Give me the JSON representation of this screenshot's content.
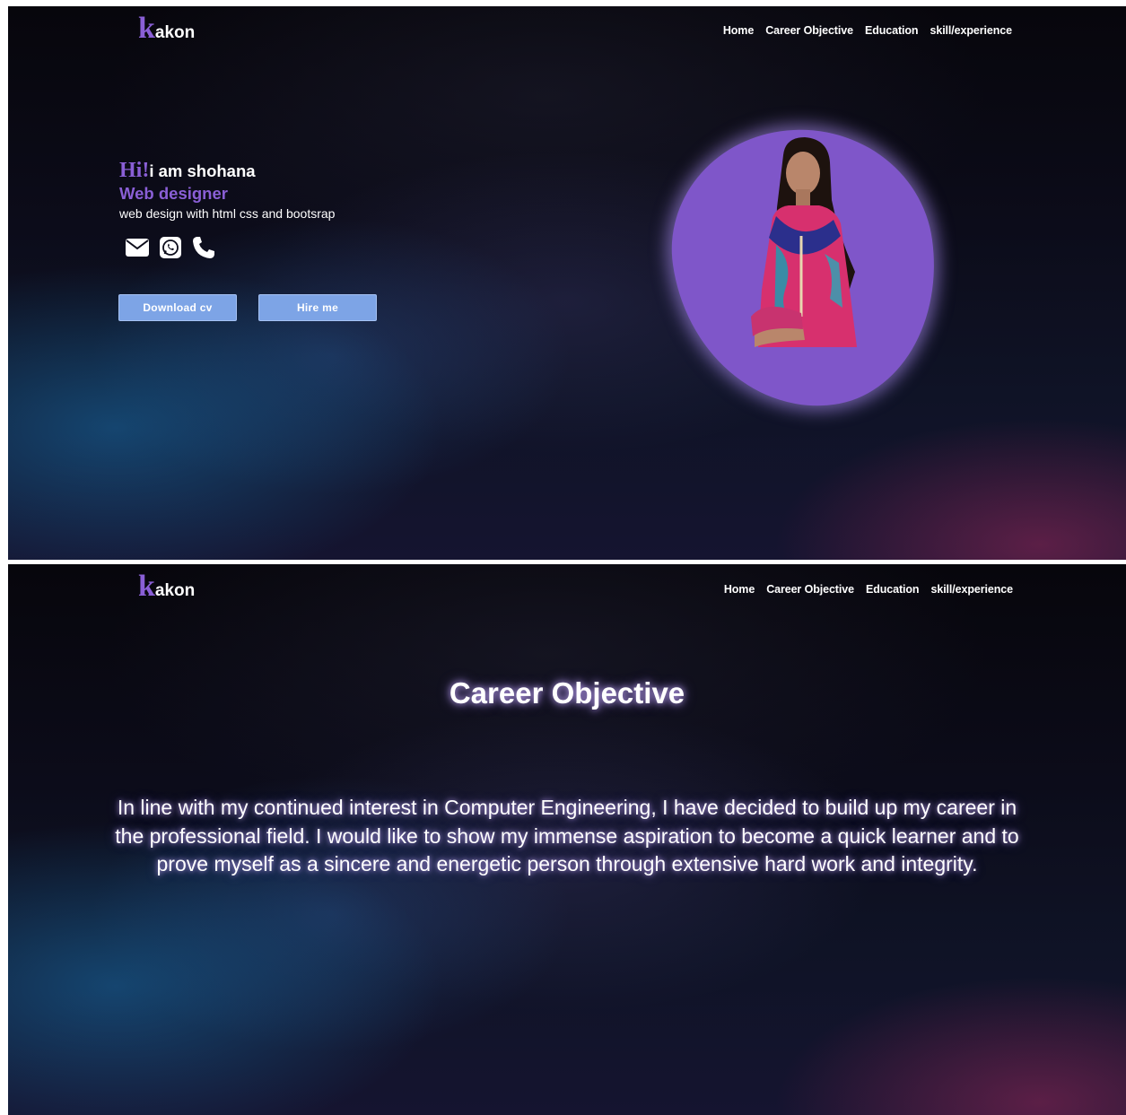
{
  "header": {
    "logo_initial": "k",
    "logo_rest": "akon",
    "nav": [
      "Home",
      "Career Objective",
      "Education",
      "skill/experience"
    ]
  },
  "hero": {
    "greeting_hi": "Hi!",
    "greeting_name": "i am shohana",
    "role": "Web designer",
    "tagline": "web design with html css and bootsrap",
    "socials": [
      "envelope-icon",
      "whatsapp-icon",
      "phone-icon"
    ],
    "buttons": {
      "download": "Download cv",
      "hire": "Hire me"
    }
  },
  "career": {
    "title": "Career Objective",
    "body": "In line with my continued interest in Computer Engineering, I have decided to build up my career in the professional field. I would like to show my immense aspiration to become a quick learner and to prove myself as a sincere and energetic person through extensive hard work and integrity."
  },
  "colors": {
    "accent": "#8a5fd6",
    "button": "#7da4e6",
    "blob": "#7f56c9"
  }
}
